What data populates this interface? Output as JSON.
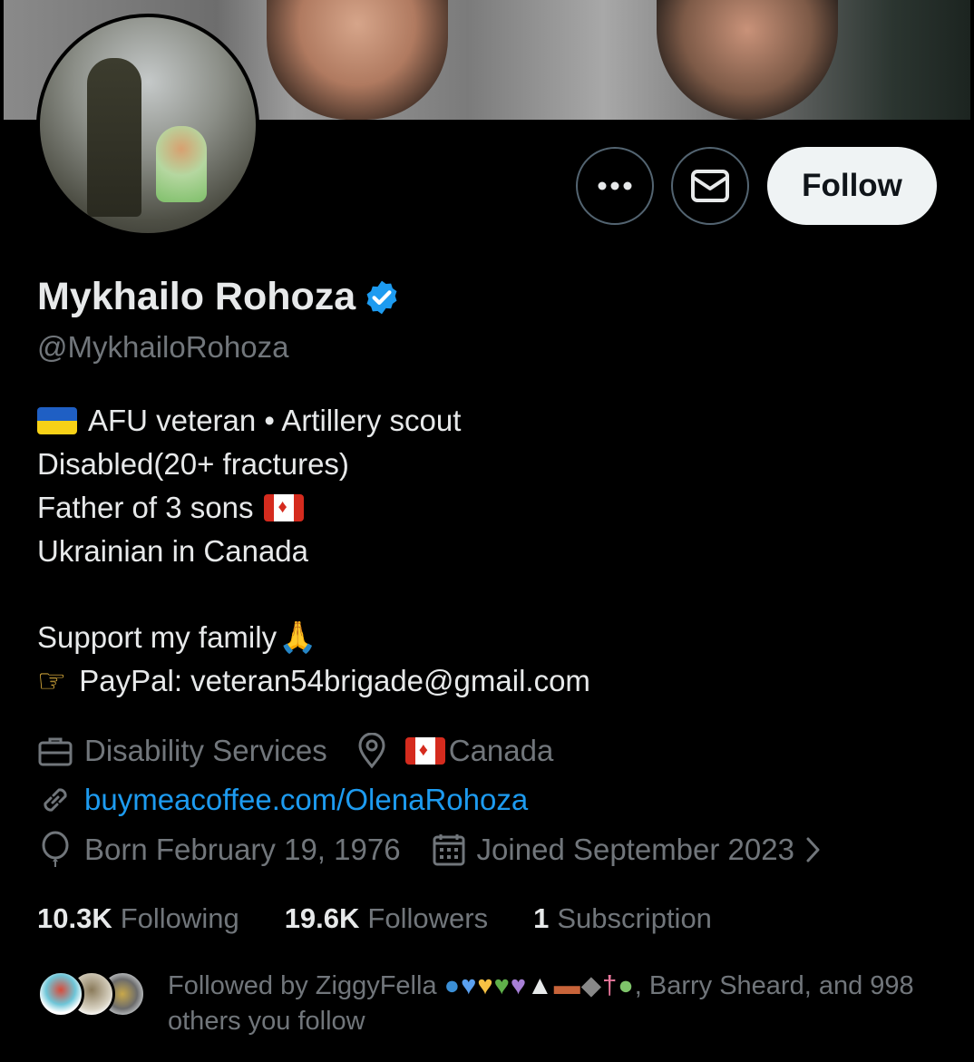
{
  "profile": {
    "display_name": "Mykhailo Rohoza",
    "handle": "@MykhailoRohoza",
    "verified": true,
    "follow_label": "Follow",
    "more_icon": "more-icon",
    "message_icon": "envelope-icon"
  },
  "bio": {
    "line1": "AFU veteran • Artillery scout",
    "line2": "Disabled(20+ fractures)",
    "line3": "Father of 3 sons",
    "line4": "Ukrainian in Canada",
    "line5": "Support my family",
    "line6": "PayPal: veteran54brigade@gmail.com"
  },
  "meta": {
    "category": "Disability Services",
    "location": "Canada",
    "website": "buymeacoffee.com/OlenaRohoza",
    "birthday": "Born February 19, 1976",
    "joined": "Joined September 2023"
  },
  "stats": {
    "following_count": "10.3K",
    "following_label": "Following",
    "followers_count": "19.6K",
    "followers_label": "Followers",
    "subscriptions_count": "1",
    "subscriptions_label": "Subscription"
  },
  "followed_by": {
    "prefix": "Followed by ZiggyFella",
    "suffix": ", Barry Sheard, and 998 others you follow"
  },
  "colors": {
    "background": "#000000",
    "text_primary": "#e7e9ea",
    "text_secondary": "#71767b",
    "link": "#1d9bf0",
    "verified": "#1d9bf0",
    "follow_button": "#eff3f4"
  }
}
